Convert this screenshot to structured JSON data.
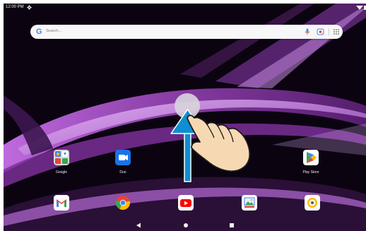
{
  "status_bar": {
    "time": "12:00 PM"
  },
  "search_bar": {
    "logo": "G",
    "placeholder": "Search..."
  },
  "apps": {
    "google_folder": {
      "label": "Google"
    },
    "duo": {
      "label": "Duo"
    },
    "play_store": {
      "label": "Play Store"
    },
    "gmail": {
      "label": ""
    },
    "chrome": {
      "label": ""
    },
    "youtube": {
      "label": ""
    },
    "photos": {
      "label": ""
    },
    "settings_app": {
      "label": ""
    }
  },
  "icons": {
    "status": [
      "gear-icon",
      "wifi-icon",
      "battery-icon"
    ],
    "search": [
      "google-logo",
      "mic-icon",
      "lens-icon",
      "app-grid-icon"
    ],
    "navigation": [
      "back-icon",
      "home-icon",
      "recents-icon"
    ],
    "gesture": [
      "swipe-up-arrow",
      "hand-pointer-icon"
    ]
  },
  "colors": {
    "wallpaper_base": "#0b0410",
    "wallpaper_purple": "#8b3da8",
    "gesture_arrow": "#0e8fd1",
    "hand": "#f6d9b3"
  }
}
